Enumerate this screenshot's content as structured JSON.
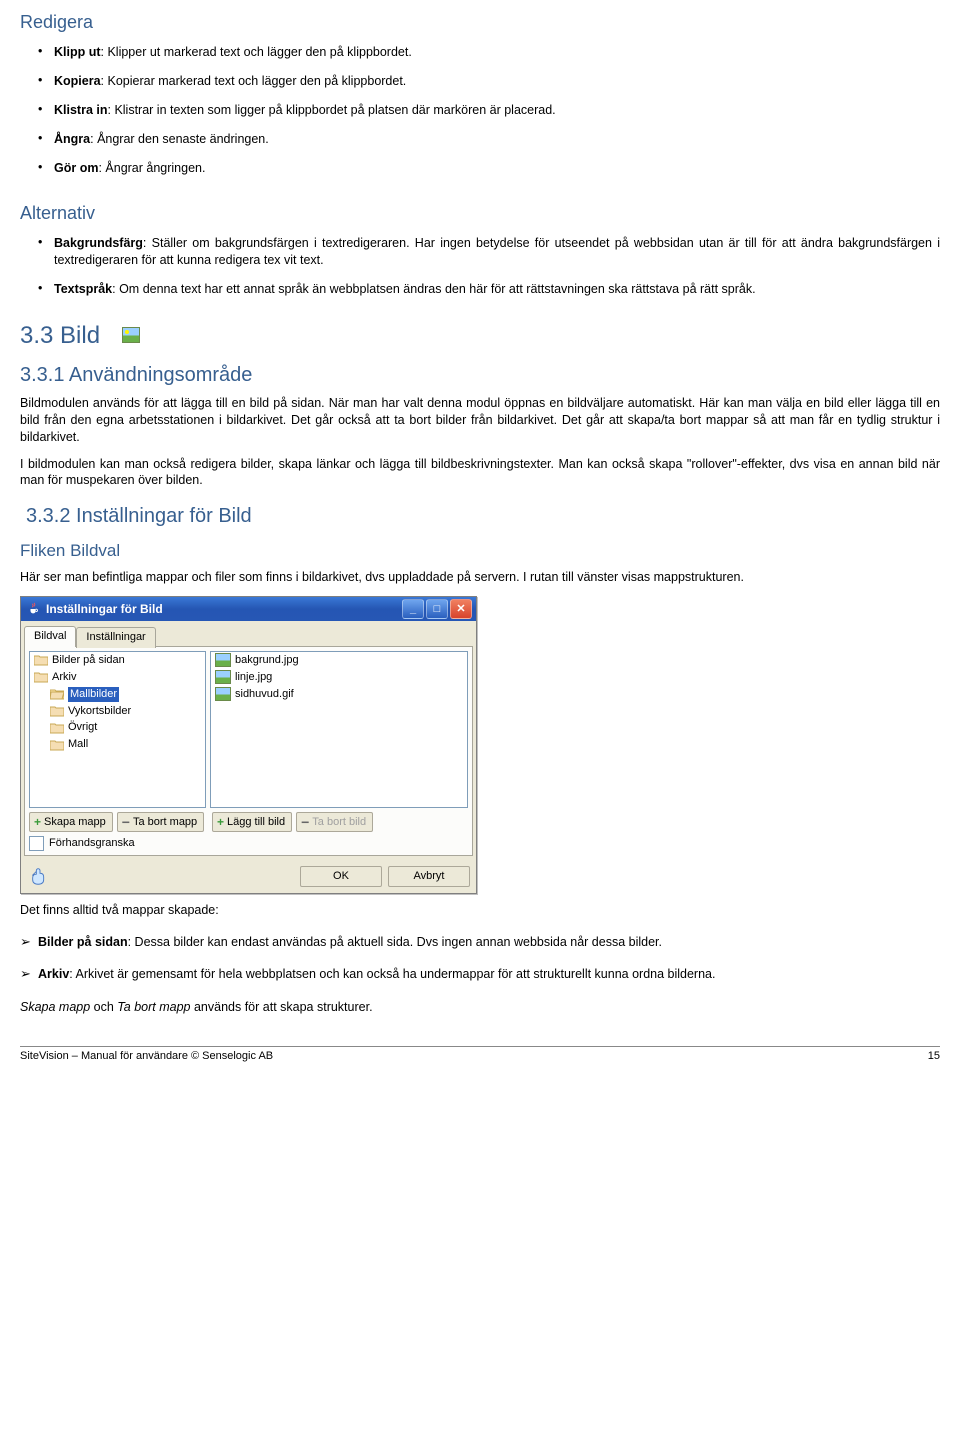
{
  "headings": {
    "redigera": "Redigera",
    "alternativ": "Alternativ",
    "bild": "3.3 Bild",
    "sub1": "3.3.1 Användningsområde",
    "sub2": "3.3.2 Inställningar för Bild",
    "fliken": "Fliken Bildval"
  },
  "redigera_items": [
    {
      "b": "Klipp ut",
      "t": ": Klipper ut markerad text och lägger den på klippbordet."
    },
    {
      "b": "Kopiera",
      "t": ": Kopierar markerad text och lägger den på klippbordet."
    },
    {
      "b": "Klistra in",
      "t": ": Klistrar in texten som ligger på klippbordet på platsen där markören är placerad."
    },
    {
      "b": "Ångra",
      "t": ": Ångrar den senaste ändringen."
    },
    {
      "b": "Gör om",
      "t": ": Ångrar ångringen."
    }
  ],
  "alt_items": [
    {
      "b": "Bakgrundsfärg",
      "t": ": Ställer om bakgrundsfärgen i textredigeraren. Har ingen betydelse för utseendet på webbsidan utan är till för att ändra bakgrundsfärgen i textredigeraren för att kunna redigera tex vit text."
    },
    {
      "b": "Textspråk",
      "t": ": Om denna text har ett annat språk än webbplatsen ändras den här för att rättstavningen ska rättstava på rätt språk."
    }
  ],
  "para": {
    "p1": "Bildmodulen används för att lägga till en bild på sidan. När man har valt denna modul öppnas en bildväljare automatiskt. Här kan man välja en bild eller lägga till en bild från den egna arbetsstationen i bildarkivet. Det går också att ta bort bilder från bildarkivet. Det går att skapa/ta bort mappar så att man får en tydlig struktur i bildarkivet.",
    "p2": "I bildmodulen kan man också redigera bilder, skapa länkar  och lägga till bildbeskrivningstexter. Man kan också skapa \"rollover\"-effekter, dvs visa en annan bild när man för muspekaren över bilden.",
    "p3": "Här ser man befintliga mappar och filer som finns i bildarkivet, dvs uppladdade på servern.  I rutan till vänster visas mappstrukturen.",
    "p4": "Det finns alltid två mappar skapade:",
    "p5_pre": "Skapa mapp",
    "p5_mid": " och ",
    "p5_mid2": "Ta bort mapp",
    "p5_post": " används för att skapa strukturer."
  },
  "arrow_items": [
    {
      "b": "Bilder på sidan",
      "t": ": Dessa bilder kan endast användas på aktuell sida. Dvs ingen annan webbsida når dessa bilder."
    },
    {
      "b": "Arkiv",
      "t": ": Arkivet är gemensamt för hela webbplatsen och kan också ha undermappar för att strukturellt kunna ordna bilderna."
    }
  ],
  "dialog": {
    "title": "Inställningar för Bild",
    "tabs": [
      "Bildval",
      "Inställningar"
    ],
    "folders_left": [
      {
        "level": 0,
        "name": "Bilder på sidan"
      },
      {
        "level": 0,
        "name": "Arkiv"
      },
      {
        "level": 1,
        "name": "Mallbilder",
        "selected": true
      },
      {
        "level": 1,
        "name": "Vykortsbilder"
      },
      {
        "level": 1,
        "name": "Övrigt"
      },
      {
        "level": 1,
        "name": "Mall"
      }
    ],
    "files_right": [
      "bakgrund.jpg",
      "linje.jpg",
      "sidhuvud.gif"
    ],
    "btns_left": [
      {
        "icon": "plus",
        "label": "Skapa mapp"
      },
      {
        "icon": "minus",
        "label": "Ta bort mapp"
      }
    ],
    "btns_right": [
      {
        "icon": "plus",
        "label": "Lägg till bild"
      },
      {
        "icon": "minus",
        "label": "Ta bort bild",
        "disabled": true
      }
    ],
    "checkbox": "Förhandsgranska",
    "ok": "OK",
    "cancel": "Avbryt"
  },
  "footer": {
    "left": "SiteVision – Manual för användare © Senselogic AB",
    "right": "15"
  }
}
